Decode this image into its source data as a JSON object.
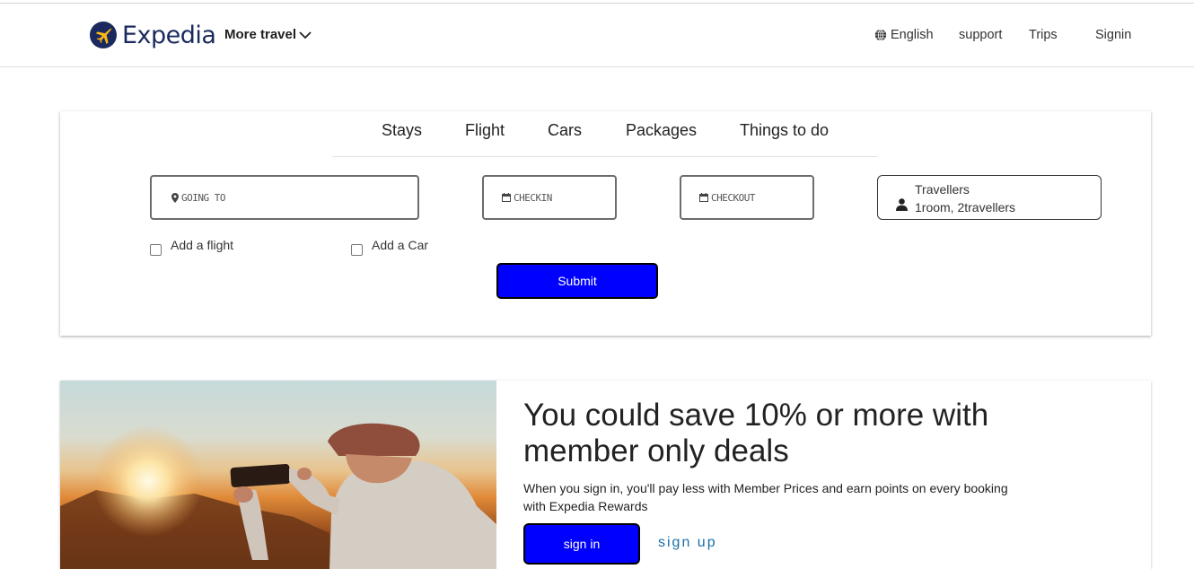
{
  "header": {
    "brand": "Expedia",
    "more_travel": "More travel",
    "language": "English",
    "support": "support",
    "trips": "Trips",
    "signin": "Signin"
  },
  "search": {
    "tabs": [
      "Stays",
      "Flight",
      "Cars",
      "Packages",
      "Things to do"
    ],
    "going_to_placeholder": "GOING TO",
    "checkin_placeholder": "CHECKIN",
    "checkout_placeholder": "CHECKOUT",
    "travellers_label": "Travellers",
    "travellers_value": "1room, 2travellers",
    "add_flight_label": "Add a flight",
    "add_car_label": "Add a Car",
    "submit_label": "Submit"
  },
  "promo": {
    "title": "You could save 10% or more with member only deals",
    "description": "When you sign in, you'll pay less with Member Prices and earn points on every booking with Expedia Rewards",
    "signin_label": "sign in",
    "signup_label": "sign up"
  },
  "colors": {
    "brand": "#1b2a5e",
    "button": "#0000ff",
    "link": "#1b6ea8"
  },
  "icons": [
    "plane-logo-icon",
    "chevron-down-icon",
    "globe-icon",
    "map-pin-icon",
    "calendar-icon",
    "person-icon"
  ]
}
